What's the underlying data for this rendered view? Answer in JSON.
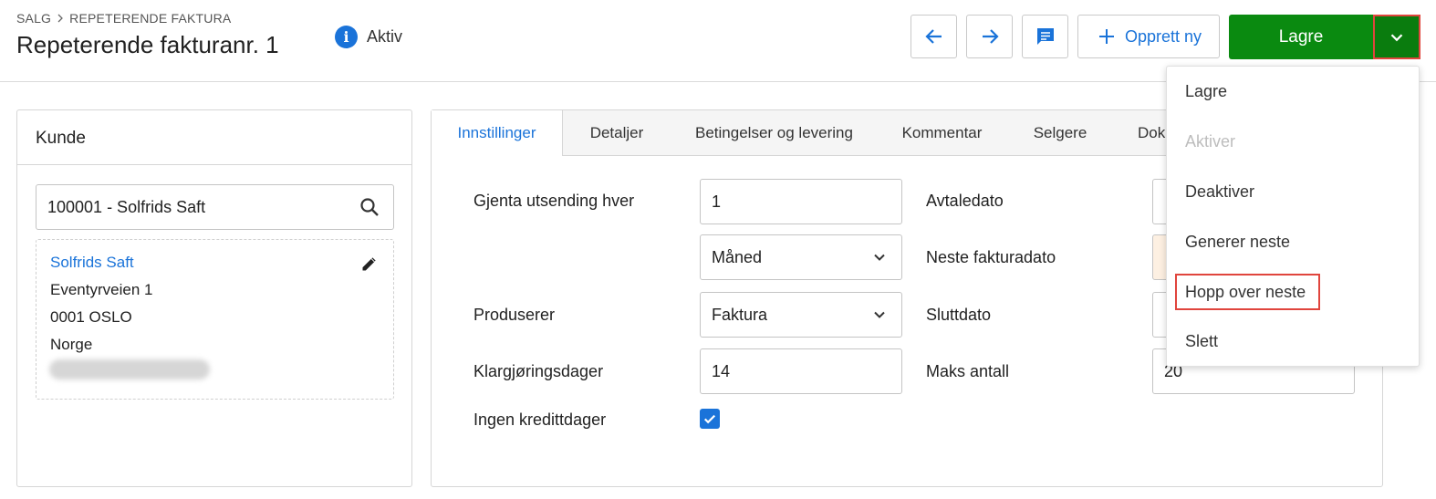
{
  "header": {
    "breadcrumb": {
      "root": "SALG",
      "current": "REPETERENDE FAKTURA"
    },
    "title": "Repeterende fakturanr. 1",
    "status": "Aktiv"
  },
  "toolbar": {
    "create_label": "Opprett ny",
    "save_label": "Lagre"
  },
  "customer": {
    "panel_title": "Kunde",
    "search_value": "100001 - Solfrids Saft",
    "name": "Solfrids Saft",
    "address_lines": [
      "Eventyrveien 1",
      "0001 OSLO",
      "Norge"
    ]
  },
  "tabs": [
    "Innstillinger",
    "Detaljer",
    "Betingelser og levering",
    "Kommentar",
    "Selgere",
    "Dok"
  ],
  "settings": {
    "repeat_label": "Gjenta utsending hver",
    "repeat_value": "1",
    "period_value": "Måned",
    "produces_label": "Produserer",
    "produces_value": "Faktura",
    "prep_days_label": "Klargjøringsdager",
    "prep_days_value": "14",
    "no_credit_label": "Ingen kredittdager",
    "no_credit_checked": true,
    "agreement_date_label": "Avtaledato",
    "next_invoice_date_label": "Neste fakturadato",
    "end_date_label": "Sluttdato",
    "max_count_label": "Maks antall",
    "max_count_value": "20"
  },
  "menu": {
    "items": [
      "Lagre",
      "Aktiver",
      "Deaktiver",
      "Generer neste",
      "Hopp over neste",
      "Slett"
    ]
  },
  "colors": {
    "accent": "#1a73d9",
    "save_green": "#0a8a10",
    "highlight": "#e0453d"
  }
}
